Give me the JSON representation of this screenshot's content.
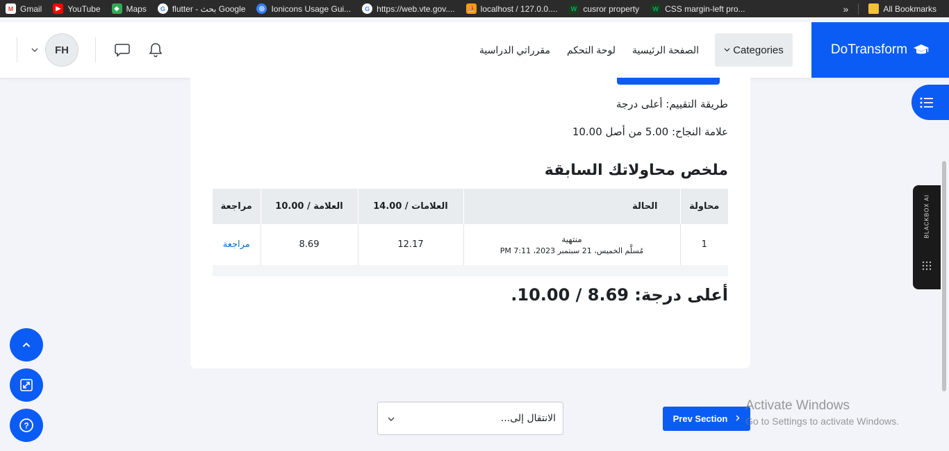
{
  "bookmarks": {
    "items": [
      {
        "label": "Gmail",
        "icon": "gmail-icon",
        "color": "#ea4335"
      },
      {
        "label": "YouTube",
        "icon": "youtube-icon",
        "color": "#ff0000"
      },
      {
        "label": "Maps",
        "icon": "maps-icon",
        "color": "#34a853"
      },
      {
        "label": "flutter - بحث Google",
        "icon": "google-icon",
        "color": "#ffffff"
      },
      {
        "label": "Ionicons Usage Gui...",
        "icon": "ionicons-icon",
        "color": "#3880ff"
      },
      {
        "label": "https://web.vte.gov....",
        "icon": "google-icon",
        "color": "#ffffff"
      },
      {
        "label": "localhost / 127.0.0....",
        "icon": "phpmyadmin-icon",
        "color": "#f89c0e"
      },
      {
        "label": "cusror property",
        "icon": "w-icon",
        "color": "#0ca678"
      },
      {
        "label": "CSS margin-left pro...",
        "icon": "w-icon",
        "color": "#0ca678"
      }
    ],
    "more": "»",
    "all_bookmarks": "All Bookmarks"
  },
  "navbar": {
    "brand": "DoTransform",
    "categories": "Categories",
    "links": [
      "الصفحة الرئيسية",
      "لوحة التحكم",
      "مقرراتي الدراسية"
    ],
    "avatar_initials": "FH",
    "accent": "#0b5cf5"
  },
  "quiz": {
    "grading_method": "طريقة التقييم: أعلى درجة",
    "pass_grade": "علامة النجاح: 5.00 من أصل 10.00",
    "summary_title": "ملخص محاولاتك السابقة",
    "table": {
      "headers": [
        "محاولة",
        "الحالة",
        "العلامات / 14.00",
        "العلامة / 10.00",
        "مراجعة"
      ],
      "rows": [
        {
          "attempt": "1",
          "status": "منتهية",
          "submitted": "مُسلَّم الخميس، 21 سبتمبر 2023، 7:11 PM",
          "marks": "12.17",
          "grade": "8.69",
          "review": "مراجعة"
        }
      ]
    },
    "highest_grade": "أعلى درجة: 8.69 / 10.00."
  },
  "bottom": {
    "jump_to": "الانتقال إلى...",
    "prev_section": "Prev Section"
  },
  "sidebar": {
    "blackbox_label": "BLACKBOX AI"
  },
  "watermark": {
    "line1": "Activate Windows",
    "line2": "Go to Settings to activate Windows."
  }
}
